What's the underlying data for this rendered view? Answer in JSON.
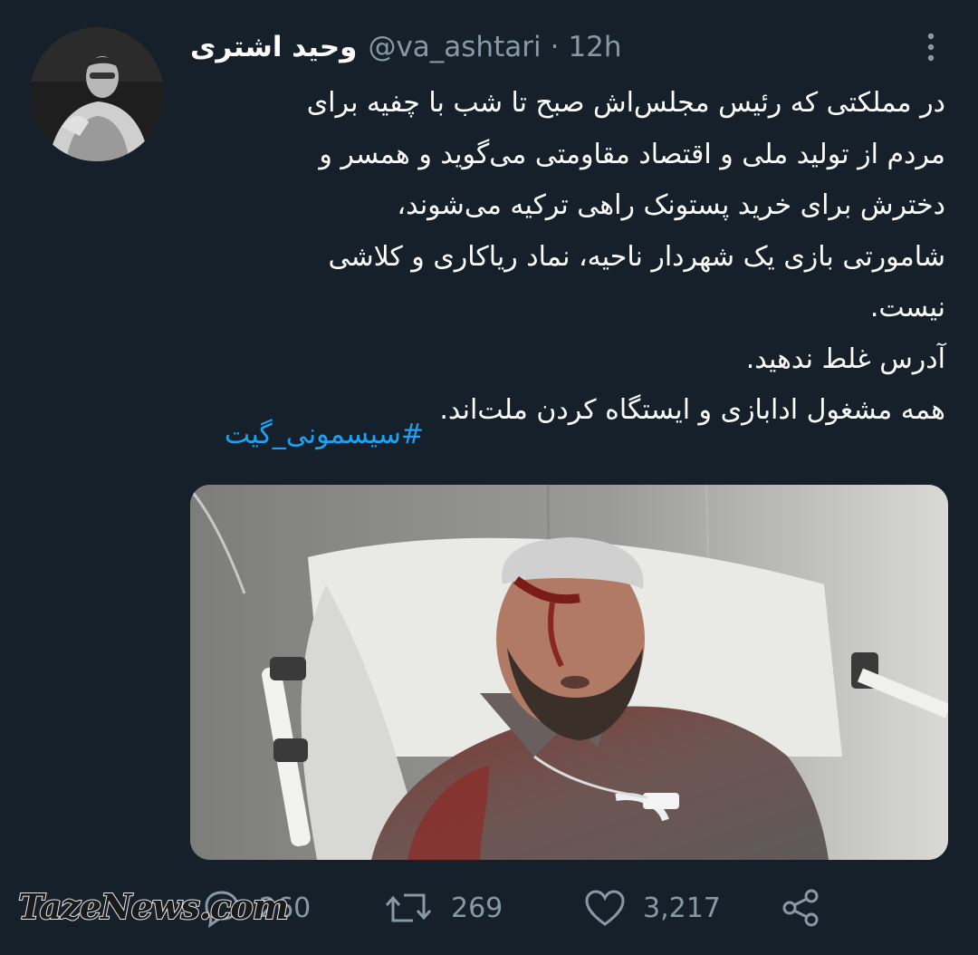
{
  "tweet": {
    "display_name": "وحید اشتری",
    "handle": "@va_ashtari",
    "separator": "·",
    "time": "12h",
    "text_lines": [
      "در مملکتی که رئیس مجلس‌اش صبح تا شب با چفیه برای",
      "مردم از تولید ملی و اقتصاد مقاومتی می‌گوید و همسر و",
      "دخترش برای خرید پستونک راهی ترکیه می‌شوند،",
      "شامورتی بازی یک شهردار ناحیه، نماد ریاکاری و کلاشی",
      "نیست.",
      "آدرس غلط ندهید.",
      "همه مشغول ادابازی و ایستگاه کردن ملت‌اند."
    ],
    "hashtag": "#سیسمونی_گیت"
  },
  "actions": {
    "reply_count": "260",
    "retweet_count": "269",
    "like_count": "3,217"
  },
  "watermark": "TazeNews.com",
  "icons": {
    "more": "more-vertical-icon",
    "reply": "reply-icon",
    "retweet": "retweet-icon",
    "like": "heart-icon",
    "share": "share-icon"
  },
  "colors": {
    "background": "#15202b",
    "secondary_text": "#8899a6",
    "link": "#1da1f2"
  }
}
